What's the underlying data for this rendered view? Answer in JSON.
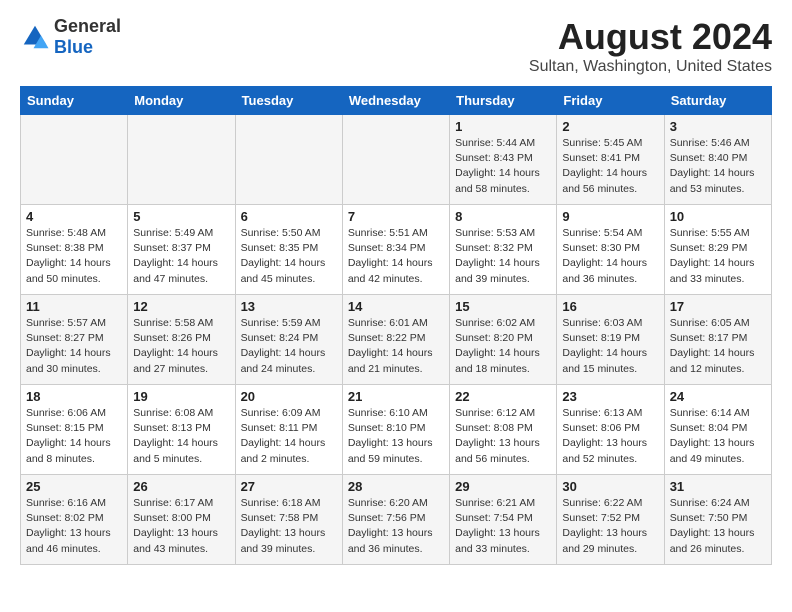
{
  "header": {
    "logo_general": "General",
    "logo_blue": "Blue",
    "month_year": "August 2024",
    "location": "Sultan, Washington, United States"
  },
  "days_of_week": [
    "Sunday",
    "Monday",
    "Tuesday",
    "Wednesday",
    "Thursday",
    "Friday",
    "Saturday"
  ],
  "weeks": [
    {
      "days": [
        {
          "number": "",
          "info": ""
        },
        {
          "number": "",
          "info": ""
        },
        {
          "number": "",
          "info": ""
        },
        {
          "number": "",
          "info": ""
        },
        {
          "number": "1",
          "info": "Sunrise: 5:44 AM\nSunset: 8:43 PM\nDaylight: 14 hours\nand 58 minutes."
        },
        {
          "number": "2",
          "info": "Sunrise: 5:45 AM\nSunset: 8:41 PM\nDaylight: 14 hours\nand 56 minutes."
        },
        {
          "number": "3",
          "info": "Sunrise: 5:46 AM\nSunset: 8:40 PM\nDaylight: 14 hours\nand 53 minutes."
        }
      ]
    },
    {
      "days": [
        {
          "number": "4",
          "info": "Sunrise: 5:48 AM\nSunset: 8:38 PM\nDaylight: 14 hours\nand 50 minutes."
        },
        {
          "number": "5",
          "info": "Sunrise: 5:49 AM\nSunset: 8:37 PM\nDaylight: 14 hours\nand 47 minutes."
        },
        {
          "number": "6",
          "info": "Sunrise: 5:50 AM\nSunset: 8:35 PM\nDaylight: 14 hours\nand 45 minutes."
        },
        {
          "number": "7",
          "info": "Sunrise: 5:51 AM\nSunset: 8:34 PM\nDaylight: 14 hours\nand 42 minutes."
        },
        {
          "number": "8",
          "info": "Sunrise: 5:53 AM\nSunset: 8:32 PM\nDaylight: 14 hours\nand 39 minutes."
        },
        {
          "number": "9",
          "info": "Sunrise: 5:54 AM\nSunset: 8:30 PM\nDaylight: 14 hours\nand 36 minutes."
        },
        {
          "number": "10",
          "info": "Sunrise: 5:55 AM\nSunset: 8:29 PM\nDaylight: 14 hours\nand 33 minutes."
        }
      ]
    },
    {
      "days": [
        {
          "number": "11",
          "info": "Sunrise: 5:57 AM\nSunset: 8:27 PM\nDaylight: 14 hours\nand 30 minutes."
        },
        {
          "number": "12",
          "info": "Sunrise: 5:58 AM\nSunset: 8:26 PM\nDaylight: 14 hours\nand 27 minutes."
        },
        {
          "number": "13",
          "info": "Sunrise: 5:59 AM\nSunset: 8:24 PM\nDaylight: 14 hours\nand 24 minutes."
        },
        {
          "number": "14",
          "info": "Sunrise: 6:01 AM\nSunset: 8:22 PM\nDaylight: 14 hours\nand 21 minutes."
        },
        {
          "number": "15",
          "info": "Sunrise: 6:02 AM\nSunset: 8:20 PM\nDaylight: 14 hours\nand 18 minutes."
        },
        {
          "number": "16",
          "info": "Sunrise: 6:03 AM\nSunset: 8:19 PM\nDaylight: 14 hours\nand 15 minutes."
        },
        {
          "number": "17",
          "info": "Sunrise: 6:05 AM\nSunset: 8:17 PM\nDaylight: 14 hours\nand 12 minutes."
        }
      ]
    },
    {
      "days": [
        {
          "number": "18",
          "info": "Sunrise: 6:06 AM\nSunset: 8:15 PM\nDaylight: 14 hours\nand 8 minutes."
        },
        {
          "number": "19",
          "info": "Sunrise: 6:08 AM\nSunset: 8:13 PM\nDaylight: 14 hours\nand 5 minutes."
        },
        {
          "number": "20",
          "info": "Sunrise: 6:09 AM\nSunset: 8:11 PM\nDaylight: 14 hours\nand 2 minutes."
        },
        {
          "number": "21",
          "info": "Sunrise: 6:10 AM\nSunset: 8:10 PM\nDaylight: 13 hours\nand 59 minutes."
        },
        {
          "number": "22",
          "info": "Sunrise: 6:12 AM\nSunset: 8:08 PM\nDaylight: 13 hours\nand 56 minutes."
        },
        {
          "number": "23",
          "info": "Sunrise: 6:13 AM\nSunset: 8:06 PM\nDaylight: 13 hours\nand 52 minutes."
        },
        {
          "number": "24",
          "info": "Sunrise: 6:14 AM\nSunset: 8:04 PM\nDaylight: 13 hours\nand 49 minutes."
        }
      ]
    },
    {
      "days": [
        {
          "number": "25",
          "info": "Sunrise: 6:16 AM\nSunset: 8:02 PM\nDaylight: 13 hours\nand 46 minutes."
        },
        {
          "number": "26",
          "info": "Sunrise: 6:17 AM\nSunset: 8:00 PM\nDaylight: 13 hours\nand 43 minutes."
        },
        {
          "number": "27",
          "info": "Sunrise: 6:18 AM\nSunset: 7:58 PM\nDaylight: 13 hours\nand 39 minutes."
        },
        {
          "number": "28",
          "info": "Sunrise: 6:20 AM\nSunset: 7:56 PM\nDaylight: 13 hours\nand 36 minutes."
        },
        {
          "number": "29",
          "info": "Sunrise: 6:21 AM\nSunset: 7:54 PM\nDaylight: 13 hours\nand 33 minutes."
        },
        {
          "number": "30",
          "info": "Sunrise: 6:22 AM\nSunset: 7:52 PM\nDaylight: 13 hours\nand 29 minutes."
        },
        {
          "number": "31",
          "info": "Sunrise: 6:24 AM\nSunset: 7:50 PM\nDaylight: 13 hours\nand 26 minutes."
        }
      ]
    }
  ]
}
